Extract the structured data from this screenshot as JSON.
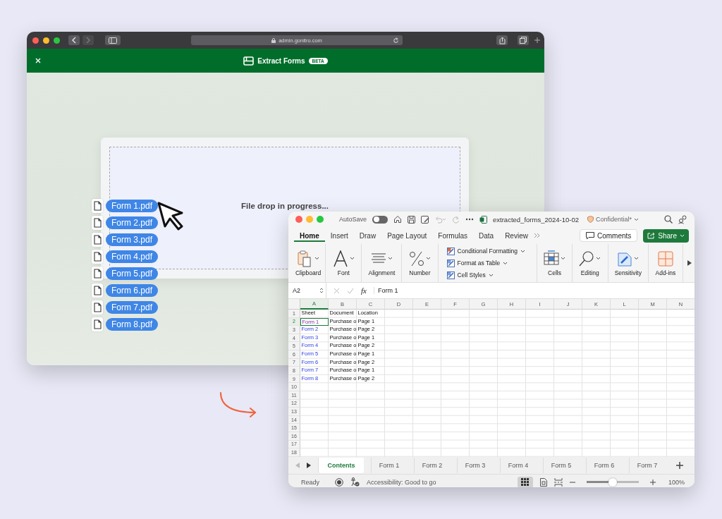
{
  "browser": {
    "url": "admin.gonitro.com",
    "header": {
      "title": "Extract Forms",
      "badge": "BETA"
    },
    "drop_zone": {
      "message": "File drop in progress..."
    }
  },
  "dragged_files": [
    {
      "name": "Form 1.pdf"
    },
    {
      "name": "Form 2.pdf"
    },
    {
      "name": "Form 3.pdf"
    },
    {
      "name": "Form 4.pdf"
    },
    {
      "name": "Form 5.pdf"
    },
    {
      "name": "Form 6.pdf"
    },
    {
      "name": "Form 7.pdf"
    },
    {
      "name": "Form 8.pdf"
    }
  ],
  "excel": {
    "autosave": {
      "label": "AutoSave",
      "on": false
    },
    "file_name": "extracted_forms_2024-10-02",
    "sensitivity_label": "Confidential*",
    "tabs": [
      {
        "label": "Home",
        "selected": true
      },
      {
        "label": "Insert",
        "selected": false
      },
      {
        "label": "Draw",
        "selected": false
      },
      {
        "label": "Page Layout",
        "selected": false
      },
      {
        "label": "Formulas",
        "selected": false
      },
      {
        "label": "Data",
        "selected": false
      },
      {
        "label": "Review",
        "selected": false
      }
    ],
    "comments_button": "Comments",
    "share_button": "Share",
    "ribbon": [
      {
        "kind": "clipboard",
        "label": "Clipboard"
      },
      {
        "kind": "font",
        "label": "Font"
      },
      {
        "kind": "alignment",
        "label": "Alignment"
      },
      {
        "kind": "number",
        "label": "Number"
      },
      {
        "kind": "styles",
        "items": [
          "Conditional Formatting",
          "Format as Table",
          "Cell Styles"
        ]
      },
      {
        "kind": "cells",
        "label": "Cells"
      },
      {
        "kind": "editing",
        "label": "Editing"
      },
      {
        "kind": "sensitivity",
        "label": "Sensitivity"
      },
      {
        "kind": "addins",
        "label": "Add-ins"
      }
    ],
    "formula_bar": {
      "name_box": "A2",
      "fx": "fx",
      "value": "Form 1"
    },
    "columns": [
      "A",
      "B",
      "C",
      "D",
      "E",
      "F",
      "G",
      "H",
      "I",
      "J",
      "K",
      "L",
      "M",
      "N"
    ],
    "rows": [
      {
        "number": "1",
        "cells": [
          {
            "text": "Sheet",
            "kind": "text",
            "selected": false
          },
          {
            "text": "Document",
            "kind": "text",
            "selected": false
          },
          {
            "text": "Location",
            "kind": "text",
            "selected": false
          }
        ]
      },
      {
        "number": "2",
        "cells": [
          {
            "text": "Form 1",
            "kind": "link",
            "visited": true,
            "selected": true
          },
          {
            "text": "Purchase o",
            "kind": "text",
            "selected": false
          },
          {
            "text": "Page 1",
            "kind": "text",
            "selected": false
          }
        ]
      },
      {
        "number": "3",
        "cells": [
          {
            "text": "Form 2",
            "kind": "link",
            "visited": false,
            "selected": false
          },
          {
            "text": "Purchase o",
            "kind": "text",
            "selected": false
          },
          {
            "text": "Page 2",
            "kind": "text",
            "selected": false
          }
        ]
      },
      {
        "number": "4",
        "cells": [
          {
            "text": "Form 3",
            "kind": "link",
            "visited": false,
            "selected": false
          },
          {
            "text": "Purchase o",
            "kind": "text",
            "selected": false
          },
          {
            "text": "Page 1",
            "kind": "text",
            "selected": false
          }
        ]
      },
      {
        "number": "5",
        "cells": [
          {
            "text": "Form 4",
            "kind": "link",
            "visited": false,
            "selected": false
          },
          {
            "text": "Purchase o",
            "kind": "text",
            "selected": false
          },
          {
            "text": "Page 2",
            "kind": "text",
            "selected": false
          }
        ]
      },
      {
        "number": "6",
        "cells": [
          {
            "text": "Form 5",
            "kind": "link",
            "visited": false,
            "selected": false
          },
          {
            "text": "Purchase o",
            "kind": "text",
            "selected": false
          },
          {
            "text": "Page 1",
            "kind": "text",
            "selected": false
          }
        ]
      },
      {
        "number": "7",
        "cells": [
          {
            "text": "Form 6",
            "kind": "link",
            "visited": false,
            "selected": false
          },
          {
            "text": "Purchase o",
            "kind": "text",
            "selected": false
          },
          {
            "text": "Page 2",
            "kind": "text",
            "selected": false
          }
        ]
      },
      {
        "number": "8",
        "cells": [
          {
            "text": "Form 7",
            "kind": "link",
            "visited": false,
            "selected": false
          },
          {
            "text": "Purchase o",
            "kind": "text",
            "selected": false
          },
          {
            "text": "Page 1",
            "kind": "text",
            "selected": false
          }
        ]
      },
      {
        "number": "9",
        "cells": [
          {
            "text": "Form 8",
            "kind": "link",
            "visited": false,
            "selected": false
          },
          {
            "text": "Purchase o",
            "kind": "text",
            "selected": false
          },
          {
            "text": "Page 2",
            "kind": "text",
            "selected": false
          }
        ]
      },
      {
        "number": "10"
      },
      {
        "number": "11"
      },
      {
        "number": "12"
      },
      {
        "number": "13"
      },
      {
        "number": "14"
      },
      {
        "number": "15"
      },
      {
        "number": "16"
      },
      {
        "number": "17"
      },
      {
        "number": "18"
      }
    ],
    "sheet_tabs": [
      {
        "label": "Contents",
        "selected": true
      },
      {
        "label": "Form 1",
        "selected": false
      },
      {
        "label": "Form 2",
        "selected": false
      },
      {
        "label": "Form 3",
        "selected": false
      },
      {
        "label": "Form 4",
        "selected": false
      },
      {
        "label": "Form 5",
        "selected": false
      },
      {
        "label": "Form 6",
        "selected": false
      },
      {
        "label": "Form 7",
        "selected": false
      }
    ],
    "status_bar": {
      "status": "Ready",
      "accessibility": "Accessibility: Good to go",
      "zoom": {
        "level": 0.5,
        "reading": "100%"
      }
    }
  }
}
